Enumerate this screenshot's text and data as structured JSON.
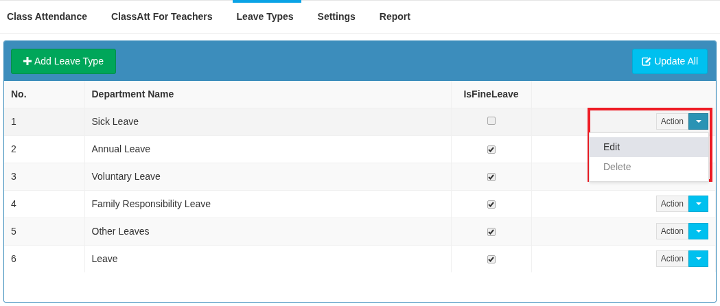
{
  "tabs": [
    {
      "label": "Class Attendance",
      "selected": false
    },
    {
      "label": "ClassAtt For Teachers",
      "selected": false
    },
    {
      "label": "Leave Types",
      "selected": true
    },
    {
      "label": "Settings",
      "selected": false
    },
    {
      "label": "Report",
      "selected": false
    }
  ],
  "toolbar": {
    "add_button": "Add Leave Type",
    "update_button": "Update All"
  },
  "table": {
    "columns": [
      "No.",
      "Department Name",
      "IsFineLeave"
    ],
    "rows": [
      {
        "no": "1",
        "name": "Sick Leave",
        "is_fine_leave": false,
        "action": "Action",
        "menu_open": true
      },
      {
        "no": "2",
        "name": "Annual Leave",
        "is_fine_leave": true
      },
      {
        "no": "3",
        "name": "Voluntary Leave",
        "is_fine_leave": true
      },
      {
        "no": "4",
        "name": "Family Responsibility Leave",
        "is_fine_leave": true,
        "action": "Action",
        "menu_open": false
      },
      {
        "no": "5",
        "name": "Other Leaves",
        "is_fine_leave": true,
        "action": "Action",
        "menu_open": false
      },
      {
        "no": "6",
        "name": "Leave",
        "is_fine_leave": true,
        "action": "Action",
        "menu_open": false
      }
    ]
  },
  "action_menu": {
    "items": [
      {
        "label": "Edit",
        "selected": true
      },
      {
        "label": "Delete",
        "selected": false
      }
    ],
    "highlighted": true
  }
}
